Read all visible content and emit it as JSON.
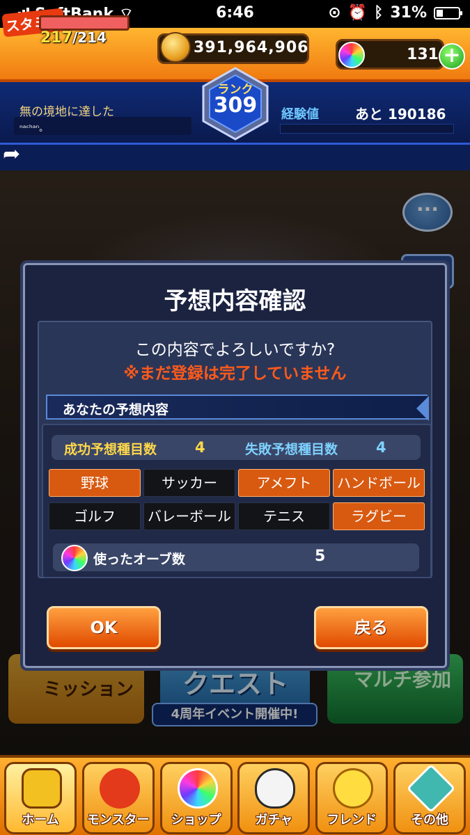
{
  "status_bar": {
    "carrier": "SoftBank",
    "time": "6:46",
    "battery": "31%"
  },
  "hud": {
    "stamina_label": "スタミナ",
    "stamina_current": "217",
    "stamina_max": "/214",
    "coins": "391,964,906",
    "orbs": "131",
    "rank_label": "ランク",
    "rank_value": "309",
    "title": "無の境地に達した",
    "user_name": "ⁿᵃᶜʰᵃⁿ。",
    "exp_label": "経験値",
    "exp_remaining": "あと 190186"
  },
  "background": {
    "mission_label": "ミッション",
    "quest_label": "クエスト",
    "multi_label": "マルチ参加",
    "event_ribbon": "4周年イベント開催中!"
  },
  "dialog": {
    "title": "予想内容確認",
    "message": "この内容でよろしいですか?",
    "warning": "※まだ登録は完了していません",
    "section_label": "あなたの予想内容",
    "success_label": "成功予想種目数",
    "success_count": "4",
    "fail_label": "失敗予想種目数",
    "fail_count": "4",
    "sports": [
      {
        "name": "野球",
        "selected": true
      },
      {
        "name": "サッカー",
        "selected": false
      },
      {
        "name": "アメフト",
        "selected": true
      },
      {
        "name": "ハンドボール",
        "selected": true
      },
      {
        "name": "ゴルフ",
        "selected": false
      },
      {
        "name": "バレーボール",
        "selected": false
      },
      {
        "name": "テニス",
        "selected": false
      },
      {
        "name": "ラグビー",
        "selected": true
      }
    ],
    "orbs_used_label": "使ったオーブ数",
    "orbs_used": "5",
    "ok_label": "OK",
    "back_label": "戻る"
  },
  "nav": {
    "items": [
      {
        "label": "ホーム",
        "icon": "home-icon"
      },
      {
        "label": "モンスター",
        "icon": "monster-icon"
      },
      {
        "label": "ショップ",
        "icon": "shop-orb-icon"
      },
      {
        "label": "ガチャ",
        "icon": "gacha-egg-icon"
      },
      {
        "label": "フレンド",
        "icon": "friend-icon"
      },
      {
        "label": "その他",
        "icon": "other-icon"
      }
    ]
  },
  "colors": {
    "selected_sport": "#d85a10",
    "warning": "#ff5a1a",
    "success": "#ffd84a",
    "fail": "#7ed2ff"
  }
}
